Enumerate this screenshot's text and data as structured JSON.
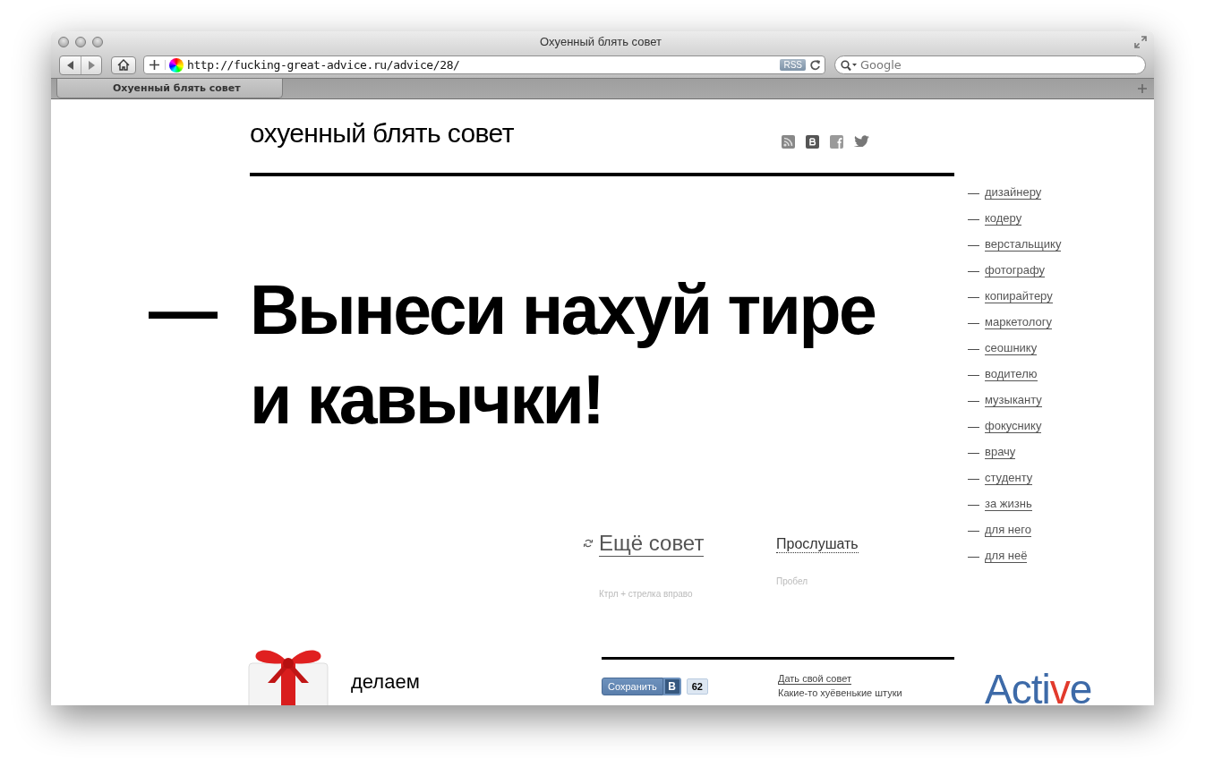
{
  "window": {
    "title": "Охуенный блять совет",
    "url": "http://fucking-great-advice.ru/advice/28/",
    "rss_badge": "RSS",
    "search": {
      "placeholder": "Google"
    },
    "tabs": [
      {
        "label": "Охуенный блять совет",
        "selected": true
      }
    ]
  },
  "header": {
    "logo": "охуенный блять совет"
  },
  "advice": {
    "dash": "—",
    "text": "Вынеси нахуй тире и кавычки!"
  },
  "categories": [
    {
      "marker": "—",
      "label": "дизайнеру"
    },
    {
      "marker": "—",
      "label": "кодеру"
    },
    {
      "marker": "—",
      "label": "верстальщику"
    },
    {
      "marker": "—",
      "label": "фотографу"
    },
    {
      "marker": "—",
      "label": "копирайтеру"
    },
    {
      "marker": "—",
      "label": "маркетологу"
    },
    {
      "marker": "—",
      "label": "сеошнику"
    },
    {
      "marker": "—",
      "label": "водителю"
    },
    {
      "marker": "—",
      "label": "музыканту"
    },
    {
      "marker": "—",
      "label": "фокуснику"
    },
    {
      "marker": "—",
      "label": "врачу"
    },
    {
      "marker": "—",
      "label": "студенту"
    },
    {
      "marker": "—",
      "label": "за жизнь"
    },
    {
      "marker": "—",
      "label": "для него"
    },
    {
      "marker": "—",
      "label": "для неё"
    }
  ],
  "actions": [
    {
      "kind": "next",
      "label": "Ещё совет",
      "hint": "Ктрл + стрелка вправо"
    },
    {
      "kind": "listen",
      "label": "Прослушать",
      "hint": "Пробел"
    }
  ],
  "footer": {
    "promo": "делаем",
    "share": {
      "label": "Сохранить",
      "badge": "В",
      "count": "62"
    },
    "links": [
      {
        "kind": "link",
        "label": "Дать свой совет"
      },
      {
        "kind": "text",
        "label": "Какие-то хуёвенькие штуки"
      }
    ],
    "sponsor": [
      {
        "text": "Acti",
        "color": "#3d6aa8"
      },
      {
        "text": "v",
        "color": "#e23a2c"
      },
      {
        "text": "e",
        "color": "#3d6aa8"
      }
    ]
  }
}
